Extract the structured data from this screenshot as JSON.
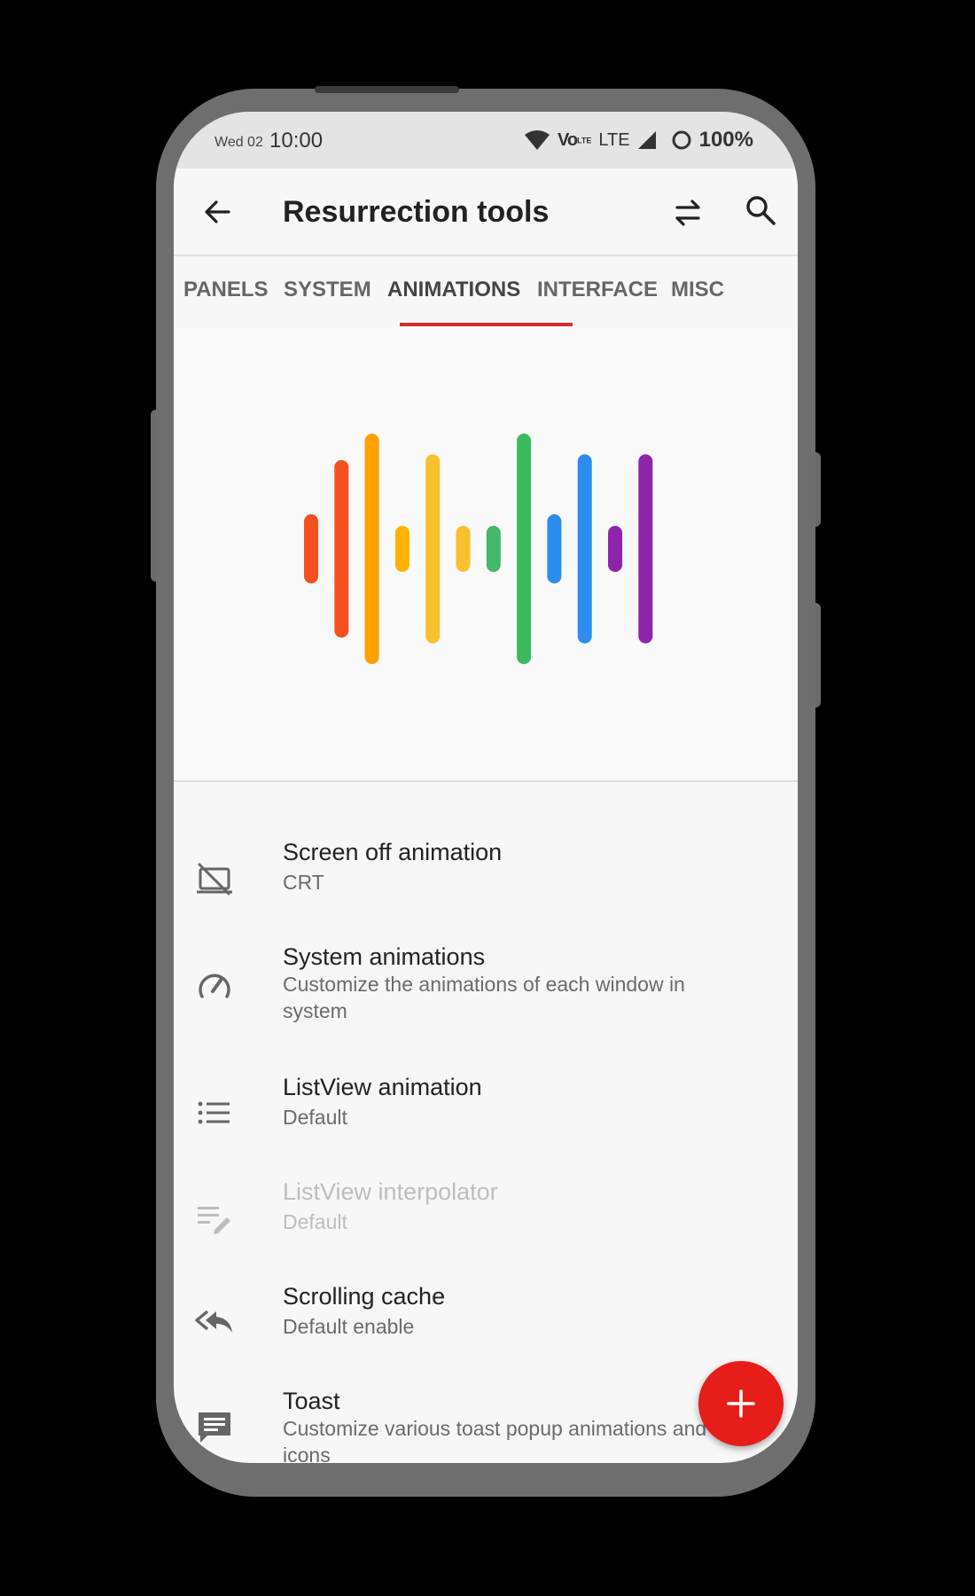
{
  "status_bar": {
    "date": "Wed 02",
    "time": "10:00",
    "volte": "Vo",
    "network": "LTE",
    "battery": "100%"
  },
  "app_bar": {
    "title": "Resurrection tools"
  },
  "tabs": [
    {
      "label": "PANELS"
    },
    {
      "label": "SYSTEM"
    },
    {
      "label": "ANIMATIONS",
      "active": true
    },
    {
      "label": "INTERFACE"
    },
    {
      "label": "MISC"
    }
  ],
  "hero": {
    "bar_colors": [
      "#f4511e",
      "#f4511e",
      "#ffa000",
      "#ffb300",
      "#fbc02d",
      "#fbc02d",
      "#43b86a",
      "#3cba5f",
      "#2d8cf0",
      "#2d8cf0",
      "#8e24aa",
      "#8e24aa"
    ],
    "bar_levels": [
      0.3,
      0.77,
      1.0,
      0.2,
      0.82,
      0.2,
      0.2,
      1.0,
      0.3,
      0.82,
      0.2,
      0.82
    ]
  },
  "settings": [
    {
      "title": "Screen off animation",
      "summary": "CRT",
      "icon": "screen-off-icon",
      "enabled": true
    },
    {
      "title": "System animations",
      "summary": "Customize the animations of each window in system",
      "icon": "speedometer-icon",
      "enabled": true
    },
    {
      "title": "ListView animation",
      "summary": "Default",
      "icon": "list-icon",
      "enabled": true
    },
    {
      "title": "ListView interpolator",
      "summary": "Default",
      "icon": "edit-list-icon",
      "enabled": false
    },
    {
      "title": "Scrolling cache",
      "summary": "Default enable",
      "icon": "reply-all-icon",
      "enabled": true
    },
    {
      "title": "Toast",
      "summary": "Customize various toast popup animations and icons",
      "icon": "message-icon",
      "enabled": true
    }
  ],
  "fab": {
    "icon": "plus-icon",
    "color": "#e61d18"
  },
  "colors": {
    "accent": "#d32f2f"
  }
}
